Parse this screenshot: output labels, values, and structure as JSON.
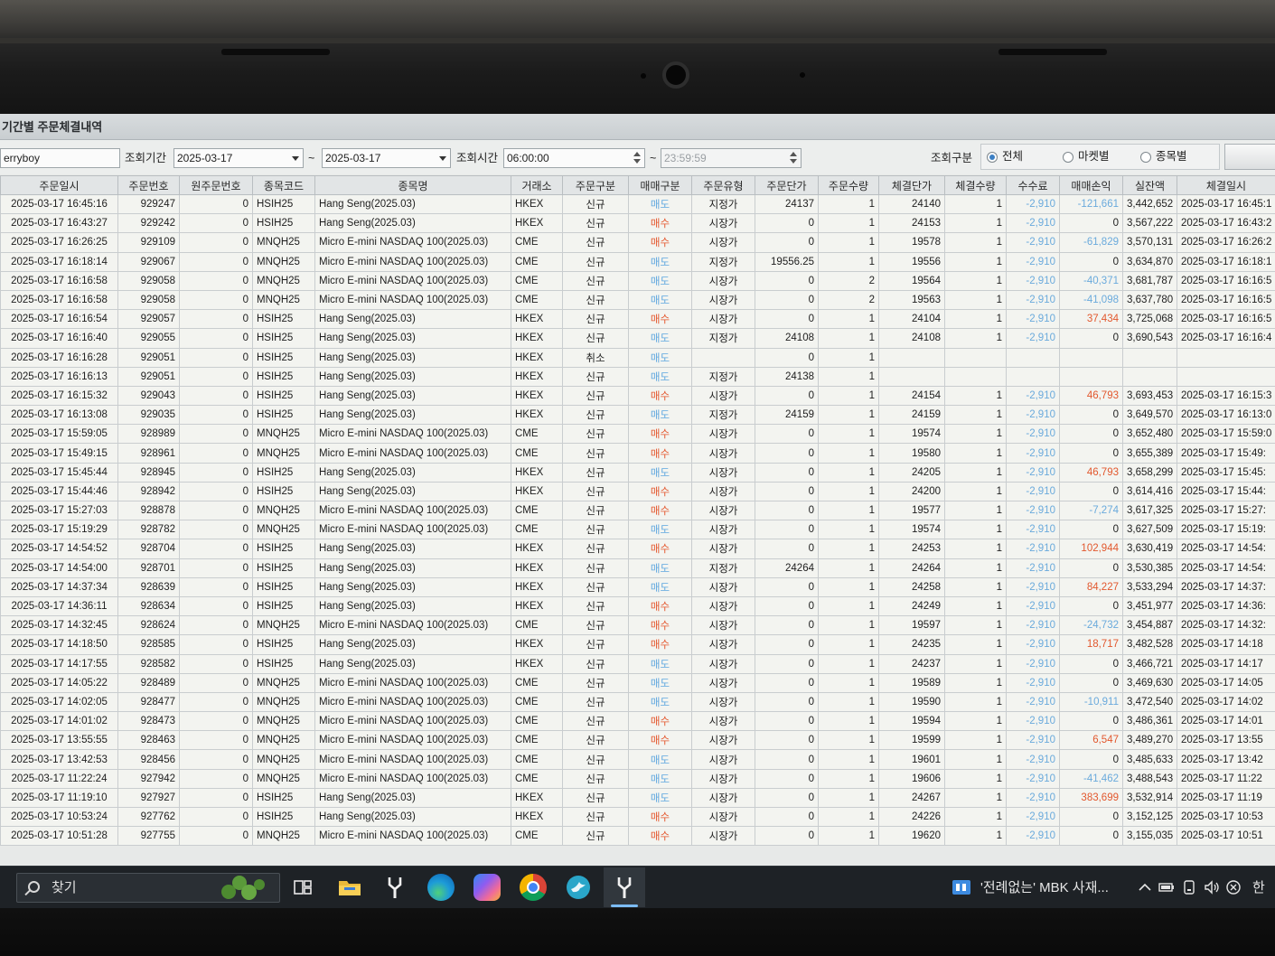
{
  "window": {
    "title": "기간별 주문체결내역"
  },
  "filters": {
    "account": "erryboy",
    "period_label": "조회기간",
    "date_from": "2025-03-17",
    "tilde": "~",
    "date_to": "2025-03-17",
    "time_label": "조회시간",
    "time_from": "06:00:00",
    "time_to": "23:59:59",
    "mode_label": "조회구분",
    "modes": [
      "전체",
      "마켓별",
      "종목별"
    ],
    "selected_mode": "전체"
  },
  "colors": {
    "sell": "#5fa7df",
    "buy": "#e4562c",
    "loss": "#6aaadc",
    "profit": "#e2582e"
  },
  "table": {
    "columns": [
      "주문일시",
      "주문번호",
      "원주문번호",
      "종목코드",
      "종목명",
      "거래소",
      "주문구분",
      "매매구분",
      "주문유형",
      "주문단가",
      "주문수량",
      "체결단가",
      "체결수량",
      "수수료",
      "매매손익",
      "실잔액",
      "체결일시"
    ],
    "rows": [
      [
        "2025-03-17 16:45:16",
        "929247",
        "0",
        "HSIH25",
        "Hang Seng(2025.03)",
        "HKEX",
        "신규",
        "매도",
        "지정가",
        "24137",
        "1",
        "24140",
        "1",
        "-2,910",
        "-121,661",
        "3,442,652",
        "2025-03-17 16:45:1"
      ],
      [
        "2025-03-17 16:43:27",
        "929242",
        "0",
        "HSIH25",
        "Hang Seng(2025.03)",
        "HKEX",
        "신규",
        "매수",
        "시장가",
        "0",
        "1",
        "24153",
        "1",
        "-2,910",
        "0",
        "3,567,222",
        "2025-03-17 16:43:2"
      ],
      [
        "2025-03-17 16:26:25",
        "929109",
        "0",
        "MNQH25",
        "Micro E-mini NASDAQ 100(2025.03)",
        "CME",
        "신규",
        "매수",
        "시장가",
        "0",
        "1",
        "19578",
        "1",
        "-2,910",
        "-61,829",
        "3,570,131",
        "2025-03-17 16:26:2"
      ],
      [
        "2025-03-17 16:18:14",
        "929067",
        "0",
        "MNQH25",
        "Micro E-mini NASDAQ 100(2025.03)",
        "CME",
        "신규",
        "매도",
        "지정가",
        "19556.25",
        "1",
        "19556",
        "1",
        "-2,910",
        "0",
        "3,634,870",
        "2025-03-17 16:18:1"
      ],
      [
        "2025-03-17 16:16:58",
        "929058",
        "0",
        "MNQH25",
        "Micro E-mini NASDAQ 100(2025.03)",
        "CME",
        "신규",
        "매도",
        "시장가",
        "0",
        "2",
        "19564",
        "1",
        "-2,910",
        "-40,371",
        "3,681,787",
        "2025-03-17 16:16:5"
      ],
      [
        "2025-03-17 16:16:58",
        "929058",
        "0",
        "MNQH25",
        "Micro E-mini NASDAQ 100(2025.03)",
        "CME",
        "신규",
        "매도",
        "시장가",
        "0",
        "2",
        "19563",
        "1",
        "-2,910",
        "-41,098",
        "3,637,780",
        "2025-03-17 16:16:5"
      ],
      [
        "2025-03-17 16:16:54",
        "929057",
        "0",
        "HSIH25",
        "Hang Seng(2025.03)",
        "HKEX",
        "신규",
        "매수",
        "시장가",
        "0",
        "1",
        "24104",
        "1",
        "-2,910",
        "37,434",
        "3,725,068",
        "2025-03-17 16:16:5"
      ],
      [
        "2025-03-17 16:16:40",
        "929055",
        "0",
        "HSIH25",
        "Hang Seng(2025.03)",
        "HKEX",
        "신규",
        "매도",
        "지정가",
        "24108",
        "1",
        "24108",
        "1",
        "-2,910",
        "0",
        "3,690,543",
        "2025-03-17 16:16:4"
      ],
      [
        "2025-03-17 16:16:28",
        "929051",
        "0",
        "HSIH25",
        "Hang Seng(2025.03)",
        "HKEX",
        "취소",
        "매도",
        "",
        "0",
        "1",
        "",
        "",
        "",
        "",
        "",
        ""
      ],
      [
        "2025-03-17 16:16:13",
        "929051",
        "0",
        "HSIH25",
        "Hang Seng(2025.03)",
        "HKEX",
        "신규",
        "매도",
        "지정가",
        "24138",
        "1",
        "",
        "",
        "",
        "",
        "",
        ""
      ],
      [
        "2025-03-17 16:15:32",
        "929043",
        "0",
        "HSIH25",
        "Hang Seng(2025.03)",
        "HKEX",
        "신규",
        "매수",
        "시장가",
        "0",
        "1",
        "24154",
        "1",
        "-2,910",
        "46,793",
        "3,693,453",
        "2025-03-17 16:15:3"
      ],
      [
        "2025-03-17 16:13:08",
        "929035",
        "0",
        "HSIH25",
        "Hang Seng(2025.03)",
        "HKEX",
        "신규",
        "매도",
        "지정가",
        "24159",
        "1",
        "24159",
        "1",
        "-2,910",
        "0",
        "3,649,570",
        "2025-03-17 16:13:0"
      ],
      [
        "2025-03-17 15:59:05",
        "928989",
        "0",
        "MNQH25",
        "Micro E-mini NASDAQ 100(2025.03)",
        "CME",
        "신규",
        "매수",
        "시장가",
        "0",
        "1",
        "19574",
        "1",
        "-2,910",
        "0",
        "3,652,480",
        "2025-03-17 15:59:0"
      ],
      [
        "2025-03-17 15:49:15",
        "928961",
        "0",
        "MNQH25",
        "Micro E-mini NASDAQ 100(2025.03)",
        "CME",
        "신규",
        "매수",
        "시장가",
        "0",
        "1",
        "19580",
        "1",
        "-2,910",
        "0",
        "3,655,389",
        "2025-03-17 15:49:"
      ],
      [
        "2025-03-17 15:45:44",
        "928945",
        "0",
        "HSIH25",
        "Hang Seng(2025.03)",
        "HKEX",
        "신규",
        "매도",
        "시장가",
        "0",
        "1",
        "24205",
        "1",
        "-2,910",
        "46,793",
        "3,658,299",
        "2025-03-17 15:45:"
      ],
      [
        "2025-03-17 15:44:46",
        "928942",
        "0",
        "HSIH25",
        "Hang Seng(2025.03)",
        "HKEX",
        "신규",
        "매수",
        "시장가",
        "0",
        "1",
        "24200",
        "1",
        "-2,910",
        "0",
        "3,614,416",
        "2025-03-17 15:44:"
      ],
      [
        "2025-03-17 15:27:03",
        "928878",
        "0",
        "MNQH25",
        "Micro E-mini NASDAQ 100(2025.03)",
        "CME",
        "신규",
        "매수",
        "시장가",
        "0",
        "1",
        "19577",
        "1",
        "-2,910",
        "-7,274",
        "3,617,325",
        "2025-03-17 15:27:"
      ],
      [
        "2025-03-17 15:19:29",
        "928782",
        "0",
        "MNQH25",
        "Micro E-mini NASDAQ 100(2025.03)",
        "CME",
        "신규",
        "매도",
        "시장가",
        "0",
        "1",
        "19574",
        "1",
        "-2,910",
        "0",
        "3,627,509",
        "2025-03-17 15:19:"
      ],
      [
        "2025-03-17 14:54:52",
        "928704",
        "0",
        "HSIH25",
        "Hang Seng(2025.03)",
        "HKEX",
        "신규",
        "매수",
        "시장가",
        "0",
        "1",
        "24253",
        "1",
        "-2,910",
        "102,944",
        "3,630,419",
        "2025-03-17 14:54:"
      ],
      [
        "2025-03-17 14:54:00",
        "928701",
        "0",
        "HSIH25",
        "Hang Seng(2025.03)",
        "HKEX",
        "신규",
        "매도",
        "지정가",
        "24264",
        "1",
        "24264",
        "1",
        "-2,910",
        "0",
        "3,530,385",
        "2025-03-17 14:54:"
      ],
      [
        "2025-03-17 14:37:34",
        "928639",
        "0",
        "HSIH25",
        "Hang Seng(2025.03)",
        "HKEX",
        "신규",
        "매도",
        "시장가",
        "0",
        "1",
        "24258",
        "1",
        "-2,910",
        "84,227",
        "3,533,294",
        "2025-03-17 14:37:"
      ],
      [
        "2025-03-17 14:36:11",
        "928634",
        "0",
        "HSIH25",
        "Hang Seng(2025.03)",
        "HKEX",
        "신규",
        "매수",
        "시장가",
        "0",
        "1",
        "24249",
        "1",
        "-2,910",
        "0",
        "3,451,977",
        "2025-03-17 14:36:"
      ],
      [
        "2025-03-17 14:32:45",
        "928624",
        "0",
        "MNQH25",
        "Micro E-mini NASDAQ 100(2025.03)",
        "CME",
        "신규",
        "매수",
        "시장가",
        "0",
        "1",
        "19597",
        "1",
        "-2,910",
        "-24,732",
        "3,454,887",
        "2025-03-17 14:32:"
      ],
      [
        "2025-03-17 14:18:50",
        "928585",
        "0",
        "HSIH25",
        "Hang Seng(2025.03)",
        "HKEX",
        "신규",
        "매수",
        "시장가",
        "0",
        "1",
        "24235",
        "1",
        "-2,910",
        "18,717",
        "3,482,528",
        "2025-03-17 14:18"
      ],
      [
        "2025-03-17 14:17:55",
        "928582",
        "0",
        "HSIH25",
        "Hang Seng(2025.03)",
        "HKEX",
        "신규",
        "매도",
        "시장가",
        "0",
        "1",
        "24237",
        "1",
        "-2,910",
        "0",
        "3,466,721",
        "2025-03-17 14:17"
      ],
      [
        "2025-03-17 14:05:22",
        "928489",
        "0",
        "MNQH25",
        "Micro E-mini NASDAQ 100(2025.03)",
        "CME",
        "신규",
        "매도",
        "시장가",
        "0",
        "1",
        "19589",
        "1",
        "-2,910",
        "0",
        "3,469,630",
        "2025-03-17 14:05"
      ],
      [
        "2025-03-17 14:02:05",
        "928477",
        "0",
        "MNQH25",
        "Micro E-mini NASDAQ 100(2025.03)",
        "CME",
        "신규",
        "매도",
        "시장가",
        "0",
        "1",
        "19590",
        "1",
        "-2,910",
        "-10,911",
        "3,472,540",
        "2025-03-17 14:02"
      ],
      [
        "2025-03-17 14:01:02",
        "928473",
        "0",
        "MNQH25",
        "Micro E-mini NASDAQ 100(2025.03)",
        "CME",
        "신규",
        "매수",
        "시장가",
        "0",
        "1",
        "19594",
        "1",
        "-2,910",
        "0",
        "3,486,361",
        "2025-03-17 14:01"
      ],
      [
        "2025-03-17 13:55:55",
        "928463",
        "0",
        "MNQH25",
        "Micro E-mini NASDAQ 100(2025.03)",
        "CME",
        "신규",
        "매수",
        "시장가",
        "0",
        "1",
        "19599",
        "1",
        "-2,910",
        "6,547",
        "3,489,270",
        "2025-03-17 13:55"
      ],
      [
        "2025-03-17 13:42:53",
        "928456",
        "0",
        "MNQH25",
        "Micro E-mini NASDAQ 100(2025.03)",
        "CME",
        "신규",
        "매도",
        "시장가",
        "0",
        "1",
        "19601",
        "1",
        "-2,910",
        "0",
        "3,485,633",
        "2025-03-17 13:42"
      ],
      [
        "2025-03-17 11:22:24",
        "927942",
        "0",
        "MNQH25",
        "Micro E-mini NASDAQ 100(2025.03)",
        "CME",
        "신규",
        "매도",
        "시장가",
        "0",
        "1",
        "19606",
        "1",
        "-2,910",
        "-41,462",
        "3,488,543",
        "2025-03-17 11:22"
      ],
      [
        "2025-03-17 11:19:10",
        "927927",
        "0",
        "HSIH25",
        "Hang Seng(2025.03)",
        "HKEX",
        "신규",
        "매도",
        "시장가",
        "0",
        "1",
        "24267",
        "1",
        "-2,910",
        "383,699",
        "3,532,914",
        "2025-03-17 11:19"
      ],
      [
        "2025-03-17 10:53:24",
        "927762",
        "0",
        "HSIH25",
        "Hang Seng(2025.03)",
        "HKEX",
        "신규",
        "매수",
        "시장가",
        "0",
        "1",
        "24226",
        "1",
        "-2,910",
        "0",
        "3,152,125",
        "2025-03-17 10:53"
      ],
      [
        "2025-03-17 10:51:28",
        "927755",
        "0",
        "MNQH25",
        "Micro E-mini NASDAQ 100(2025.03)",
        "CME",
        "신규",
        "매수",
        "시장가",
        "0",
        "1",
        "19620",
        "1",
        "-2,910",
        "0",
        "3,155,035",
        "2025-03-17 10:51"
      ]
    ]
  },
  "taskbar": {
    "search_placeholder": "찾기",
    "pinned": [
      "task-view-icon",
      "file-explorer-icon",
      "y-app-icon",
      "edge-icon",
      "copilot-icon",
      "chrome-icon",
      "bird-app-icon",
      "y-app-active-icon"
    ],
    "notification": "'전례없는' MBK 사재...",
    "ime": "한"
  }
}
